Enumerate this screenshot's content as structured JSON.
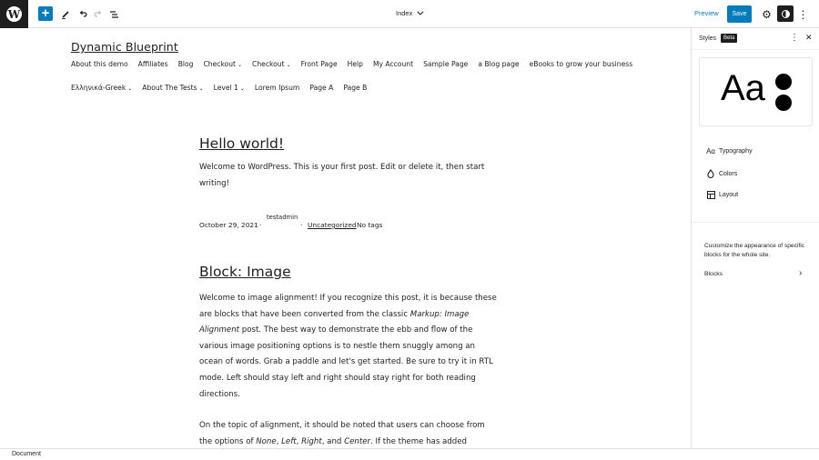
{
  "topbar": {
    "logo": "wordpress-logo",
    "add_label": "+",
    "tools": [
      "tools-pencil-icon",
      "undo-icon",
      "redo-icon",
      "list-view-icon"
    ],
    "template_title": "Index",
    "preview_label": "Preview",
    "save_label": "Save"
  },
  "canvas": {
    "site_title": "Dynamic Blueprint",
    "nav_row1": [
      {
        "label": "About this demo",
        "submenu": false
      },
      {
        "label": "Affiliates",
        "submenu": false
      },
      {
        "label": "Blog",
        "submenu": false
      },
      {
        "label": "Checkout",
        "submenu": true
      },
      {
        "label": "Checkout",
        "submenu": true
      },
      {
        "label": "Front Page",
        "submenu": false
      },
      {
        "label": "Help",
        "submenu": false
      },
      {
        "label": "My Account",
        "submenu": false
      },
      {
        "label": "Sample Page",
        "submenu": false
      },
      {
        "label": "a Blog page",
        "submenu": false
      },
      {
        "label": "eBooks to grow your business",
        "submenu": false
      }
    ],
    "nav_row2": [
      {
        "label": "Ελληνικά-Greek",
        "submenu": true
      },
      {
        "label": "About The Tests",
        "submenu": true
      },
      {
        "label": "Level 1",
        "submenu": true
      },
      {
        "label": "Lorem Ipsum",
        "submenu": false
      },
      {
        "label": "Page A",
        "submenu": false
      },
      {
        "label": "Page B",
        "submenu": false
      }
    ],
    "posts": [
      {
        "title": "Hello world!",
        "paragraphs": [
          "Welcome to WordPress. This is your first post. Edit or delete it, then start writing!"
        ],
        "meta": {
          "date": "October 29, 2021",
          "author": "testadmin",
          "category": "Uncategorized",
          "tags": "No tags",
          "separator": "·"
        }
      },
      {
        "title": "Block: Image",
        "p1_a": "Welcome to image alignment! If you recognize this post, it is because these are blocks that have been converted from the classic ",
        "p1_em": "Markup: Image Alignment",
        "p1_b": " post. The best way to demonstrate the ebb and flow of the various image positioning options is to nestle them snuggly among an ocean of words. Grab a paddle and let's get started. Be sure to try it in RTL mode. Left should stay left and right should stay right for both reading directions.",
        "p2_a": "On the topic of alignment, it should be noted that users can choose from the options of ",
        "p2_none": "None",
        "p2_c1": ", ",
        "p2_left": "Left",
        "p2_c2": ", ",
        "p2_right": "Right",
        "p2_and": ", and ",
        "p2_center": "Center",
        "p2_b": ". If the theme has added"
      }
    ]
  },
  "sidebar": {
    "title": "Styles",
    "badge": "Beta",
    "preview_text": "Aa",
    "items": [
      {
        "label": "Typography",
        "icon": "typography-icon",
        "glyph": "Aɑ"
      },
      {
        "label": "Colors",
        "icon": "droplet-icon",
        "glyph": "♢"
      },
      {
        "label": "Layout",
        "icon": "layout-icon",
        "glyph": ""
      }
    ],
    "description": "Customize the appearance of specific blocks for the whole site.",
    "blocks_label": "Blocks"
  },
  "footer": {
    "breadcrumb": "Document"
  }
}
